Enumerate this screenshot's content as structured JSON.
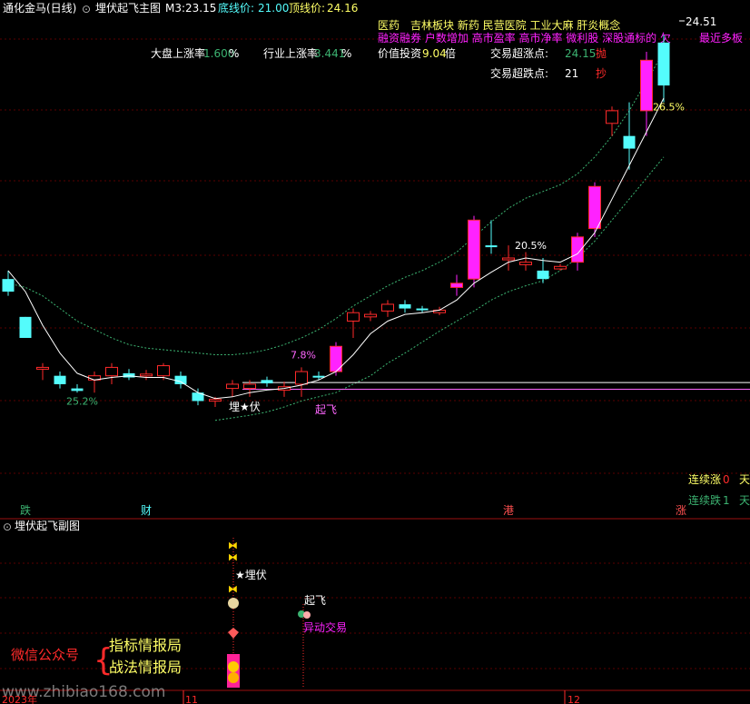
{
  "header": {
    "stock_title": "通化金马(日线)",
    "indicator_name": "埋伏起飞主图",
    "m3_label": "M3:",
    "m3_value": "23.15",
    "bottom_price_label": "底线价:",
    "bottom_price_value": "21.00",
    "top_price_label": "顶线价:",
    "top_price_value": "24.16"
  },
  "info": {
    "sector_row1": "医药　吉林板块 新药 民营医院 工业大麻 肝炎概念",
    "sector_row2": "融资融券 户数增加 高市盈率 高市净率 微利股 深股通标的 欠",
    "sector_row2_tail": "最近多板",
    "market_label": "大盘上涨率",
    "market_value": "1.600",
    "market_unit": "%",
    "industry_label": "行业上涨率",
    "industry_value": "3.441",
    "industry_unit": "%",
    "value_label": "价值投资",
    "value_value": "9.04",
    "value_unit": "倍",
    "up_point_label": "交易超涨点:",
    "up_point_value": "24.15",
    "up_point_tag": "抛",
    "down_point_label": "交易超跌点:",
    "down_point_value": "21",
    "down_point_tag": "抄",
    "consec_up_label": "连续涨",
    "consec_up_value": "0",
    "consec_up_unit": "天",
    "consec_down_label": "连续跌",
    "consec_down_value": "1",
    "consec_down_unit": "天"
  },
  "sub": {
    "title": "埋伏起飞副图",
    "ambush_label": "★埋伏",
    "takeoff_label": "起飞",
    "abnormal_label": "异动交易",
    "wechat_label": "微信公众号",
    "brand1": "指标情报局",
    "brand2": "战法情报局",
    "watermark": "www.zhibiao168.com"
  },
  "xaxis": {
    "year": "2023年",
    "m11": "11",
    "m12": "12"
  },
  "colors": {
    "up": "#ff2a2a",
    "down": "#54fcfc",
    "magenta": "#ff22ff",
    "ma": "#ffffff",
    "band": "#3cb371",
    "grid": "#5a0000"
  },
  "chart_data": {
    "type": "candlestick",
    "title": "埋伏起飞主图",
    "ylim": [
      18.9,
      24.6
    ],
    "max_label": "24.51",
    "candles": [
      {
        "o": 21.5,
        "h": 21.6,
        "l": 21.3,
        "c": 21.35,
        "t": "down"
      },
      {
        "o": 21.05,
        "h": 21.05,
        "l": 20.8,
        "c": 20.8,
        "t": "down"
      },
      {
        "o": 20.45,
        "h": 20.5,
        "l": 20.3,
        "c": 20.45,
        "t": "up"
      },
      {
        "o": 20.35,
        "h": 20.4,
        "l": 20.2,
        "c": 20.25,
        "t": "down"
      },
      {
        "o": 20.2,
        "h": 20.25,
        "l": 20.15,
        "c": 20.17,
        "t": "down"
      },
      {
        "o": 20.3,
        "h": 20.4,
        "l": 20.15,
        "c": 20.35,
        "t": "up"
      },
      {
        "o": 20.35,
        "h": 20.5,
        "l": 20.25,
        "c": 20.45,
        "t": "up"
      },
      {
        "o": 20.38,
        "h": 20.43,
        "l": 20.3,
        "c": 20.33,
        "t": "down"
      },
      {
        "o": 20.35,
        "h": 20.42,
        "l": 20.3,
        "c": 20.37,
        "t": "up"
      },
      {
        "o": 20.35,
        "h": 20.5,
        "l": 20.3,
        "c": 20.47,
        "t": "up"
      },
      {
        "o": 20.35,
        "h": 20.4,
        "l": 20.2,
        "c": 20.25,
        "t": "down"
      },
      {
        "o": 20.15,
        "h": 20.2,
        "l": 20.0,
        "c": 20.05,
        "t": "down"
      },
      {
        "o": 20.05,
        "h": 20.1,
        "l": 19.98,
        "c": 20.07,
        "t": "up"
      },
      {
        "o": 20.2,
        "h": 20.3,
        "l": 20.1,
        "c": 20.25,
        "t": "up"
      },
      {
        "o": 20.25,
        "h": 20.3,
        "l": 20.1,
        "c": 20.2,
        "t": "up"
      },
      {
        "o": 20.3,
        "h": 20.34,
        "l": 20.22,
        "c": 20.26,
        "t": "down"
      },
      {
        "o": 20.18,
        "h": 20.28,
        "l": 20.1,
        "c": 20.22,
        "t": "up"
      },
      {
        "o": 20.25,
        "h": 20.45,
        "l": 20.1,
        "c": 20.4,
        "t": "up"
      },
      {
        "o": 20.35,
        "h": 20.4,
        "l": 20.3,
        "c": 20.33,
        "t": "down"
      },
      {
        "o": 20.4,
        "h": 20.75,
        "l": 20.35,
        "c": 20.7,
        "t": "magenta"
      },
      {
        "o": 21.0,
        "h": 21.15,
        "l": 20.8,
        "c": 21.1,
        "t": "up"
      },
      {
        "o": 21.05,
        "h": 21.12,
        "l": 21.0,
        "c": 21.08,
        "t": "up"
      },
      {
        "o": 21.12,
        "h": 21.25,
        "l": 21.05,
        "c": 21.2,
        "t": "up"
      },
      {
        "o": 21.2,
        "h": 21.25,
        "l": 21.1,
        "c": 21.15,
        "t": "down"
      },
      {
        "o": 21.15,
        "h": 21.18,
        "l": 21.1,
        "c": 21.13,
        "t": "down"
      },
      {
        "o": 21.1,
        "h": 21.17,
        "l": 21.07,
        "c": 21.13,
        "t": "up"
      },
      {
        "o": 21.4,
        "h": 21.55,
        "l": 21.3,
        "c": 21.45,
        "t": "magenta"
      },
      {
        "o": 22.2,
        "h": 22.25,
        "l": 21.4,
        "c": 21.5,
        "t": "magenta"
      },
      {
        "o": 21.9,
        "h": 22.2,
        "l": 21.8,
        "c": 21.9,
        "t": "down"
      },
      {
        "o": 21.75,
        "h": 21.9,
        "l": 21.6,
        "c": 21.75,
        "t": "up"
      },
      {
        "o": 21.7,
        "h": 21.82,
        "l": 21.6,
        "c": 21.67,
        "t": "up"
      },
      {
        "o": 21.6,
        "h": 21.75,
        "l": 21.45,
        "c": 21.5,
        "t": "down"
      },
      {
        "o": 21.65,
        "h": 21.68,
        "l": 21.6,
        "c": 21.62,
        "t": "up"
      },
      {
        "o": 22.0,
        "h": 22.05,
        "l": 21.6,
        "c": 21.7,
        "t": "magenta"
      },
      {
        "o": 22.6,
        "h": 22.65,
        "l": 22.0,
        "c": 22.1,
        "t": "magenta"
      },
      {
        "o": 23.5,
        "h": 23.55,
        "l": 23.2,
        "c": 23.35,
        "t": "up"
      },
      {
        "o": 23.2,
        "h": 23.6,
        "l": 22.8,
        "c": 23.05,
        "t": "down"
      },
      {
        "o": 23.5,
        "h": 24.2,
        "l": 23.2,
        "c": 24.1,
        "t": "magenta"
      },
      {
        "o": 24.31,
        "h": 24.4,
        "l": 23.6,
        "c": 23.8,
        "t": "down"
      }
    ],
    "ma": [
      21.6,
      21.35,
      20.95,
      20.62,
      20.38,
      20.3,
      20.33,
      20.35,
      20.33,
      20.33,
      20.28,
      20.15,
      20.08,
      20.1,
      20.15,
      20.18,
      20.2,
      20.24,
      20.3,
      20.4,
      20.6,
      20.85,
      21.0,
      21.08,
      21.1,
      21.13,
      21.25,
      21.45,
      21.58,
      21.7,
      21.75,
      21.72,
      21.7,
      21.8,
      22.05,
      22.45,
      22.85,
      23.25,
      23.65
    ],
    "band_upper": [
      21.45,
      21.4,
      21.3,
      21.15,
      21.0,
      20.9,
      20.8,
      20.72,
      20.68,
      20.66,
      20.64,
      20.62,
      20.6,
      20.6,
      20.62,
      20.66,
      20.72,
      20.8,
      20.9,
      21.03,
      21.18,
      21.3,
      21.42,
      21.52,
      21.6,
      21.7,
      21.82,
      22.0,
      22.18,
      22.34,
      22.46,
      22.54,
      22.62,
      22.75,
      22.95,
      23.2,
      23.5,
      23.85,
      24.2
    ],
    "band_lower": [
      null,
      null,
      null,
      null,
      null,
      null,
      null,
      null,
      null,
      null,
      null,
      null,
      19.82,
      19.85,
      19.88,
      19.92,
      19.98,
      20.05,
      20.1,
      20.15,
      20.25,
      20.35,
      20.5,
      20.62,
      20.75,
      20.88,
      21.0,
      21.12,
      21.25,
      21.35,
      21.42,
      21.48,
      21.6,
      21.75,
      21.95,
      22.2,
      22.45,
      22.7,
      22.95
    ],
    "price_labels": [
      {
        "i": 4,
        "text": "25.2%",
        "price": 20.05
      },
      {
        "i": 17,
        "text": "7.8%",
        "price": 20.6
      },
      {
        "i": 30,
        "text": "20.5%",
        "price": 21.9
      },
      {
        "i": 38,
        "text": "26.5%",
        "price": 23.55
      }
    ],
    "lines": [
      {
        "price": 20.27,
        "from": 14,
        "to": 44
      },
      {
        "price": 20.19,
        "from": 14,
        "to": 44
      }
    ],
    "events": [
      {
        "i": 13,
        "text": "埋★伏",
        "price": 20.0
      },
      {
        "i": 18,
        "text": "起飞",
        "price": 19.97
      }
    ],
    "bottom_tags": [
      {
        "i": 1,
        "text": "跌",
        "color": "#3cb371"
      },
      {
        "i": 8,
        "text": "财",
        "color": "#54fcfc"
      },
      {
        "i": 29,
        "text": "港",
        "color": "#ff5050"
      },
      {
        "i": 39,
        "text": "涨",
        "color": "#ff5050"
      }
    ]
  }
}
